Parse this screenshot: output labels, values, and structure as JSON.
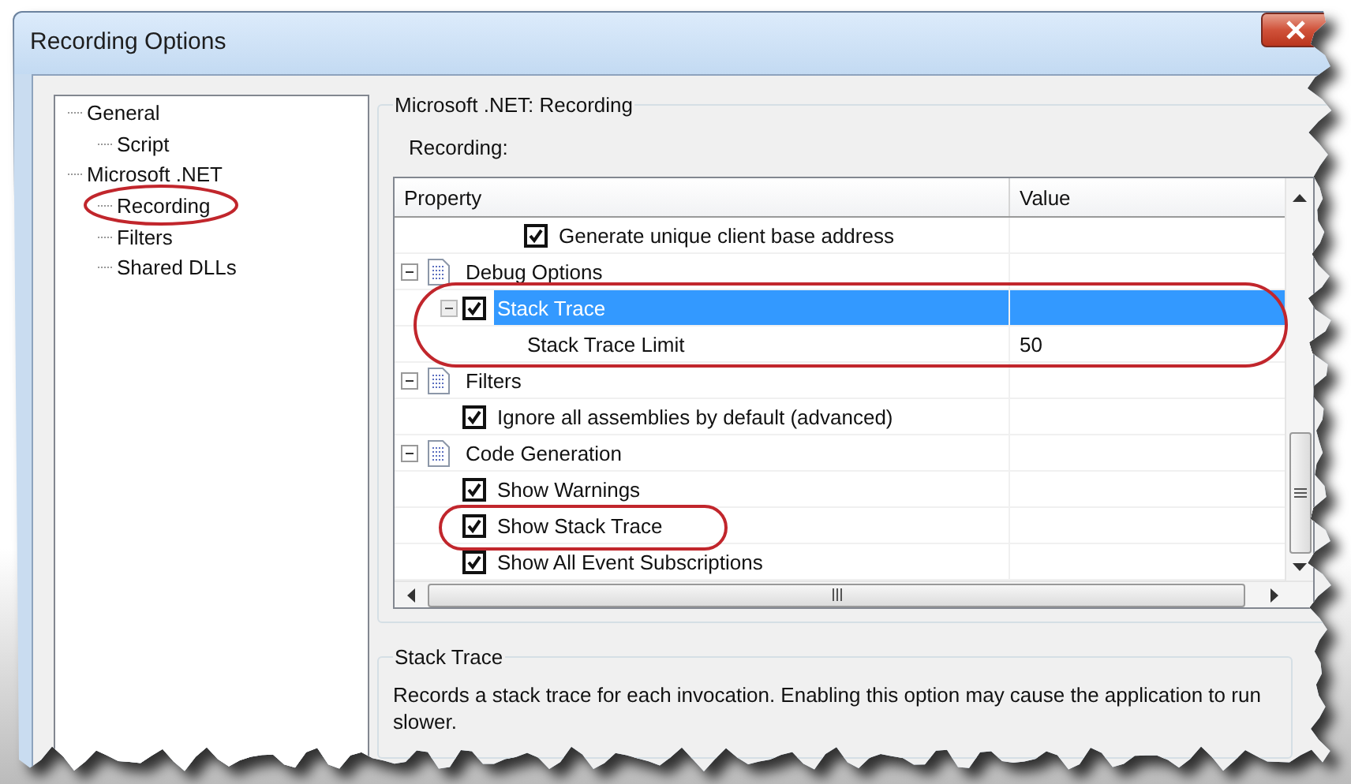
{
  "window": {
    "title": "Recording Options"
  },
  "nav_tree": [
    {
      "label": "General",
      "children": [
        {
          "label": "Script"
        }
      ]
    },
    {
      "label": "Microsoft .NET",
      "children": [
        {
          "label": "Recording"
        },
        {
          "label": "Filters"
        },
        {
          "label": "Shared DLLs"
        }
      ]
    }
  ],
  "settings_group": {
    "title": "Microsoft .NET: Recording",
    "label": "Recording:"
  },
  "property_grid": {
    "columns": [
      "Property",
      "Value"
    ],
    "rows": [
      {
        "kind": "option",
        "label": "Generate unique client base address",
        "checked": true,
        "selected": false
      },
      {
        "kind": "category",
        "label": "Debug Options",
        "expanded": true,
        "selected": false,
        "children": [
          {
            "kind": "option",
            "label": "Stack Trace",
            "checked": true,
            "selected": true,
            "expanded": true,
            "children": [
              {
                "kind": "setting",
                "label": "Stack Trace Limit",
                "value": "50",
                "selected": false
              }
            ]
          }
        ]
      },
      {
        "kind": "category",
        "label": "Filters",
        "expanded": true,
        "selected": false,
        "children": [
          {
            "kind": "option",
            "label": "Ignore all assemblies by default (advanced)",
            "checked": true,
            "selected": false
          }
        ]
      },
      {
        "kind": "category",
        "label": "Code Generation",
        "expanded": true,
        "selected": false,
        "children": [
          {
            "kind": "option",
            "label": "Show Warnings",
            "checked": true,
            "selected": false
          },
          {
            "kind": "option",
            "label": "Show Stack Trace",
            "checked": true,
            "selected": false
          },
          {
            "kind": "option",
            "label": "Show All Event Subscriptions",
            "checked": true,
            "selected": false
          }
        ]
      }
    ]
  },
  "description": {
    "title": "Stack Trace",
    "text": "Records a stack trace for each invocation. Enabling this option may cause the application to run slower."
  }
}
